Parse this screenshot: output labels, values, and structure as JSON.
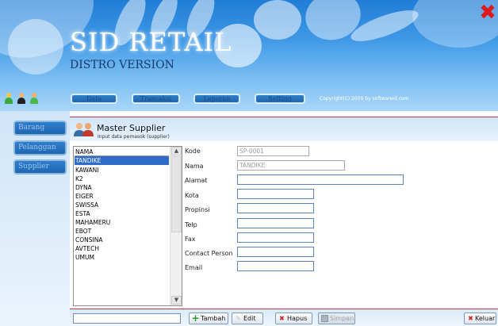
{
  "app": {
    "title": "SID RETAIL",
    "subtitle": "DISTRO VERSION",
    "copyright": "Copyright(C)  2009 by softwareid.com"
  },
  "nav": {
    "items": [
      {
        "label": "Data"
      },
      {
        "label": "Transaksi"
      },
      {
        "label": "Laporan"
      },
      {
        "label": "Setting"
      }
    ]
  },
  "sidebar": {
    "items": [
      {
        "label": "Barang"
      },
      {
        "label": "Pelanggan"
      },
      {
        "label": "Supplier"
      }
    ]
  },
  "form": {
    "title": "Master Supplier",
    "subtitle": "Input data pemasok (supplier)",
    "fields": [
      {
        "label": "Kode",
        "value": "SP-0001"
      },
      {
        "label": "Nama",
        "value": "TANDIKE"
      },
      {
        "label": "Alamat",
        "value": ""
      },
      {
        "label": "Kota",
        "value": ""
      },
      {
        "label": "Propinsi",
        "value": ""
      },
      {
        "label": "Telp",
        "value": ""
      },
      {
        "label": "Fax",
        "value": ""
      },
      {
        "label": "Contact Person",
        "value": ""
      },
      {
        "label": "Email",
        "value": ""
      }
    ]
  },
  "list": {
    "header": "NAMA",
    "selected": "TANDIKE",
    "items": [
      "TANDIKE",
      "KAWANI",
      "K2",
      "DYNA",
      "EIGER",
      "SWISSA",
      "ESTA",
      "MAHAMERU",
      "EBOT",
      "CONSINA",
      "AVTECH",
      "UMUM"
    ]
  },
  "toolbar": {
    "tambah": "Tambah",
    "edit": "Edit",
    "hapus": "Hapus",
    "simpan": "Simpan",
    "keluar": "Keluar"
  },
  "colors": {
    "accent": "#2f6bc8",
    "header_blue": "#1f7dd6",
    "divider_red": "#c8383a",
    "close_red": "#e0191c"
  },
  "icons": {
    "close": "close-x-icon",
    "users": [
      "user-icon",
      "user-icon",
      "user-icon"
    ],
    "title": "users-icon",
    "tambah": "plus-icon",
    "edit": "pencil-icon",
    "hapus": "delete-x-icon",
    "simpan": "save-icon",
    "keluar": "exit-x-icon"
  }
}
